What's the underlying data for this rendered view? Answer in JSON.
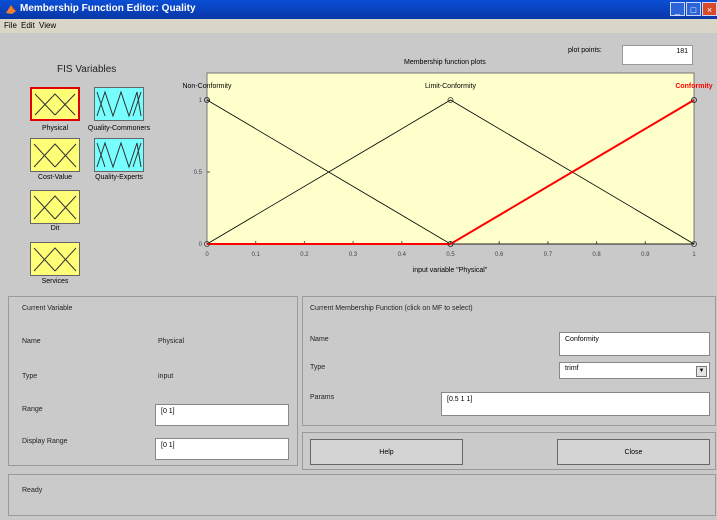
{
  "window": {
    "title": "Membership Function Editor: Quality"
  },
  "menu": [
    "File",
    "Edit",
    "View"
  ],
  "fis_variables": {
    "heading": "FIS Variables",
    "items": [
      {
        "label": "Physical",
        "kind": "input",
        "selected": true
      },
      {
        "label": "Quality-Commoners",
        "kind": "output",
        "selected": false
      },
      {
        "label": "Cost-Value",
        "kind": "input",
        "selected": false
      },
      {
        "label": "Quality-Experts",
        "kind": "output",
        "selected": false
      },
      {
        "label": "Dit",
        "kind": "input",
        "selected": false
      },
      {
        "label": "Services",
        "kind": "input",
        "selected": false
      }
    ]
  },
  "plot": {
    "title": "Membership function plots",
    "plot_points_label": "plot points:",
    "plot_points_value": "181",
    "xlabel": "input variable \"Physical\"",
    "mf_labels": [
      "Non-Conformity",
      "Limit-Conformity",
      "Conformity"
    ]
  },
  "chart_data": {
    "type": "line",
    "xlim": [
      0,
      1
    ],
    "ylim": [
      0,
      1
    ],
    "x_ticks": [
      "0",
      "0.1",
      "0.2",
      "0.3",
      "0.4",
      "0.5",
      "0.6",
      "0.7",
      "0.8",
      "0.9",
      "1"
    ],
    "y_ticks": [
      "0",
      "0.5",
      "1"
    ],
    "xlabel": "input variable \"Physical\"",
    "series": [
      {
        "name": "Non-Conformity",
        "params": [
          0,
          0,
          0.5
        ],
        "points": [
          [
            0,
            1
          ],
          [
            0.5,
            0
          ],
          [
            1,
            0
          ]
        ],
        "color": "#000000"
      },
      {
        "name": "Limit-Conformity",
        "params": [
          0,
          0.5,
          1
        ],
        "points": [
          [
            0,
            0
          ],
          [
            0.5,
            1
          ],
          [
            1,
            0
          ]
        ],
        "color": "#000000"
      },
      {
        "name": "Conformity",
        "params": [
          0.5,
          1,
          1
        ],
        "points": [
          [
            0,
            0
          ],
          [
            0.5,
            0
          ],
          [
            1,
            1
          ]
        ],
        "color": "#ff0000",
        "selected": true
      }
    ]
  },
  "current_variable": {
    "heading": "Current Variable",
    "name_label": "Name",
    "name_value": "Physical",
    "type_label": "Type",
    "type_value": "input",
    "range_label": "Range",
    "range_value": "[0 1]",
    "display_range_label": "Display Range",
    "display_range_value": "[0 1]"
  },
  "current_mf": {
    "heading": "Current Membership Function (click on MF to select)",
    "name_label": "Name",
    "name_value": "Conformity",
    "type_label": "Type",
    "type_value": "trimf",
    "params_label": "Params",
    "params_value": "[0.5 1 1]"
  },
  "buttons": {
    "help": "Help",
    "close": "Close"
  },
  "status": {
    "text": "Ready"
  },
  "colors": {
    "plot_bg": "#ffffcc",
    "selected_mf": "#ff0000",
    "input_var": "#ffff77",
    "output_var": "#77ffff"
  }
}
